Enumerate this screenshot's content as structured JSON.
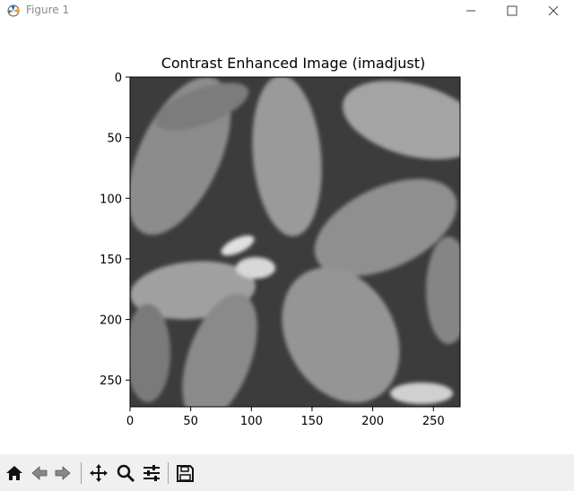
{
  "window": {
    "title": "Figure 1",
    "controls": [
      "minimize-icon",
      "maximize-icon",
      "close-icon"
    ]
  },
  "chart_data": {
    "type": "image",
    "title": "Contrast Enhanced Image (imadjust)",
    "xlim": [
      0,
      272
    ],
    "ylim": [
      272,
      0
    ],
    "xticks": [
      0,
      50,
      100,
      150,
      200,
      250
    ],
    "yticks": [
      0,
      50,
      100,
      150,
      200,
      250
    ],
    "xticklabels": [
      "0",
      "50",
      "100",
      "150",
      "200",
      "250"
    ],
    "yticklabels": [
      "0",
      "50",
      "100",
      "150",
      "200",
      "250"
    ],
    "image_description_colors": [
      "#7f7f7f",
      "#cfcfcf",
      "#3a3a3a"
    ]
  },
  "toolbar": {
    "tools": [
      {
        "icon": "home-icon",
        "group": 1
      },
      {
        "icon": "back-arrow-icon",
        "group": 1
      },
      {
        "icon": "forward-arrow-icon",
        "group": 1
      },
      {
        "icon": "pan-icon",
        "group": 2
      },
      {
        "icon": "zoom-icon",
        "group": 2
      },
      {
        "icon": "configure-subplots-icon",
        "group": 2
      },
      {
        "icon": "save-icon",
        "group": 3
      }
    ]
  }
}
